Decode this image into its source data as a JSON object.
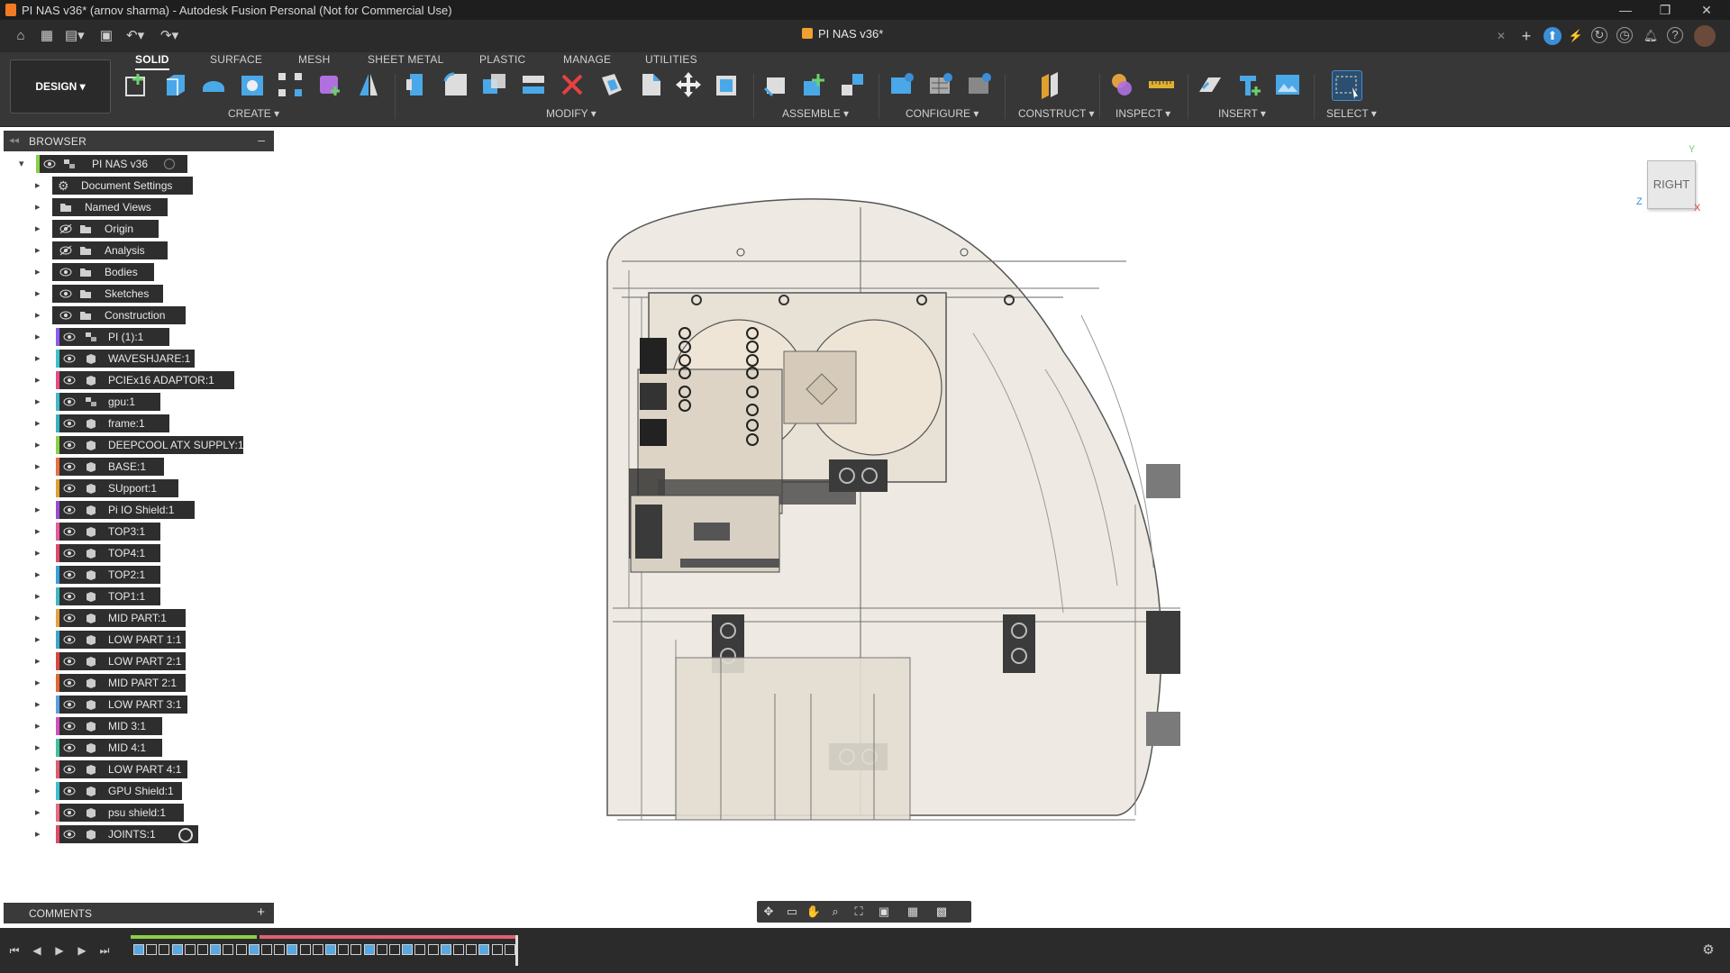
{
  "window": {
    "title": "PI NAS v36* (arnov sharma) - Autodesk Fusion Personal (Not for Commercial Use)",
    "controls": [
      "—",
      "❐",
      "✕"
    ]
  },
  "document_tab": {
    "label": "PI NAS v36*",
    "close": "✕"
  },
  "ribbon": {
    "workspace": "DESIGN ▾",
    "tabs": [
      "SOLID",
      "SURFACE",
      "MESH",
      "SHEET METAL",
      "PLASTIC",
      "MANAGE",
      "UTILITIES"
    ],
    "active_tab": "SOLID",
    "groups": [
      "CREATE ▾",
      "MODIFY ▾",
      "ASSEMBLE ▾",
      "CONFIGURE ▾",
      "CONSTRUCT ▾",
      "INSPECT ▾",
      "INSERT ▾",
      "SELECT ▾"
    ]
  },
  "browser": {
    "title": "BROWSER",
    "root": "PI NAS v36",
    "items": [
      {
        "label": "Document Settings",
        "icon": "gear-icon",
        "color": "#2e2e2e"
      },
      {
        "label": "Named Views",
        "icon": "folder-icon",
        "color": "#2e2e2e"
      },
      {
        "label": "Origin",
        "icon": "folder-icon",
        "color": "#2e2e2e"
      },
      {
        "label": "Analysis",
        "icon": "folder-icon",
        "color": "#2e2e2e"
      },
      {
        "label": "Bodies",
        "icon": "folder-icon",
        "color": "#2e2e2e"
      },
      {
        "label": "Sketches",
        "icon": "folder-icon",
        "color": "#2e2e2e"
      },
      {
        "label": "Construction",
        "icon": "folder-icon",
        "color": "#2e2e2e"
      },
      {
        "label": "PI (1):1",
        "icon": "assembly-icon",
        "color": "#8a5cf0"
      },
      {
        "label": "WAVESHJARE:1",
        "icon": "component-icon",
        "color": "#3dc2c8"
      },
      {
        "label": "PCIEx16 ADAPTOR:1",
        "icon": "component-icon",
        "color": "#e84a8a"
      },
      {
        "label": "gpu:1",
        "icon": "assembly-icon",
        "color": "#42b8c8"
      },
      {
        "label": "frame:1",
        "icon": "component-icon",
        "color": "#3ab0c0"
      },
      {
        "label": "DEEPCOOL ATX SUPPLY:1",
        "icon": "component-icon",
        "color": "#8ad045"
      },
      {
        "label": "BASE:1",
        "icon": "component-icon",
        "color": "#e87040"
      },
      {
        "label": "SUpport:1",
        "icon": "component-icon",
        "color": "#e0a030"
      },
      {
        "label": "Pi IO Shield:1",
        "icon": "component-icon",
        "color": "#9a4cd0"
      },
      {
        "label": "TOP3:1",
        "icon": "component-icon",
        "color": "#e85a9a"
      },
      {
        "label": "TOP4:1",
        "icon": "component-icon",
        "color": "#e04a6a"
      },
      {
        "label": "TOP2:1",
        "icon": "component-icon",
        "color": "#3aa0d8"
      },
      {
        "label": "TOP1:1",
        "icon": "component-icon",
        "color": "#40b8c0"
      },
      {
        "label": "MID PART:1",
        "icon": "component-icon",
        "color": "#e8a040"
      },
      {
        "label": "LOW PART 1:1",
        "icon": "component-icon",
        "color": "#3aa8c8"
      },
      {
        "label": "LOW PART 2:1",
        "icon": "component-icon",
        "color": "#d84a3a"
      },
      {
        "label": "MID PART 2:1",
        "icon": "component-icon",
        "color": "#e06a30"
      },
      {
        "label": "LOW PART 3:1",
        "icon": "component-icon",
        "color": "#5aa0e0"
      },
      {
        "label": "MID 3:1",
        "icon": "component-icon",
        "color": "#d050c0"
      },
      {
        "label": "MID 4:1",
        "icon": "component-icon",
        "color": "#40c0a0"
      },
      {
        "label": "LOW PART 4:1",
        "icon": "component-icon",
        "color": "#e05a70"
      },
      {
        "label": "GPU Shield:1",
        "icon": "component-icon",
        "color": "#3ac0d0"
      },
      {
        "label": "psu shield:1",
        "icon": "component-icon",
        "color": "#e86a80"
      },
      {
        "label": "JOINTS:1",
        "icon": "component-icon",
        "color": "#e04a6a"
      }
    ]
  },
  "comments": {
    "title": "COMMENTS",
    "add": "+"
  },
  "viewcube": {
    "face": "RIGHT",
    "axis_y": "Y",
    "axis_z": "Z",
    "axis_x": "X"
  },
  "colors": {
    "accent": "#0696d7",
    "ribbon_bg": "#373737",
    "titlebar_bg": "#1e1e1e",
    "timeline_green": "#8ad045",
    "timeline_red": "#e06070"
  }
}
